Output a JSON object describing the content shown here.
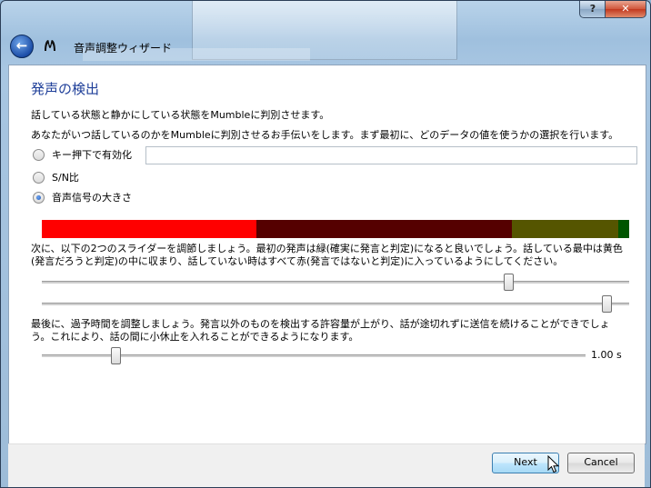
{
  "window": {
    "title": "音声調整ウィザード",
    "help_label": "?",
    "close_label": "✕"
  },
  "page": {
    "heading": "発声の検出",
    "intro": "話している状態と静かにしている状態をMumbleに判別させます。",
    "intro2": "あなたがいつ話しているのかをMumbleに判別させるお手伝いをします。まず最初に、どのデータの値を使うかの選択を行います。",
    "options": [
      {
        "label": "キー押下で有効化",
        "selected": false
      },
      {
        "label": "S/N比",
        "selected": false
      },
      {
        "label": "音声信号の大きさ",
        "selected": true
      }
    ],
    "ptt_value": "",
    "meter": {
      "segments": [
        {
          "fraction": 0.366,
          "color": "#ff0000"
        },
        {
          "fraction": 0.434,
          "color": "#550000"
        },
        {
          "fraction": 0.181,
          "color": "#555500"
        },
        {
          "fraction": 0.019,
          "color": "#005500"
        }
      ]
    },
    "instructions": "次に、以下の2つのスライダーを調節しましょう。最初の発声は緑(確実に発言と判定)になると良いでしょう。話している最中は黄色(発言だろうと判定)の中に収まり、話していない時はすべて赤(発言ではないと判定)に入っているようにしてください。",
    "slider_silence": 0.8,
    "slider_speech": 0.97,
    "holdtime_text": "最後に、過予時間を調整しましょう。発言以外のものを検出する許容量が上がり、話が途切れずに送信を続けることができでしょう。これにより、話の間に小休止を入れることができるようになります。",
    "holdtime_slider": 0.13,
    "holdtime_value": "1.00 s"
  },
  "buttons": {
    "next": "Next",
    "cancel": "Cancel"
  },
  "icons": {
    "back": "back-arrow-icon",
    "app": "mumble-icon",
    "cursor": "mouse-pointer-icon"
  }
}
